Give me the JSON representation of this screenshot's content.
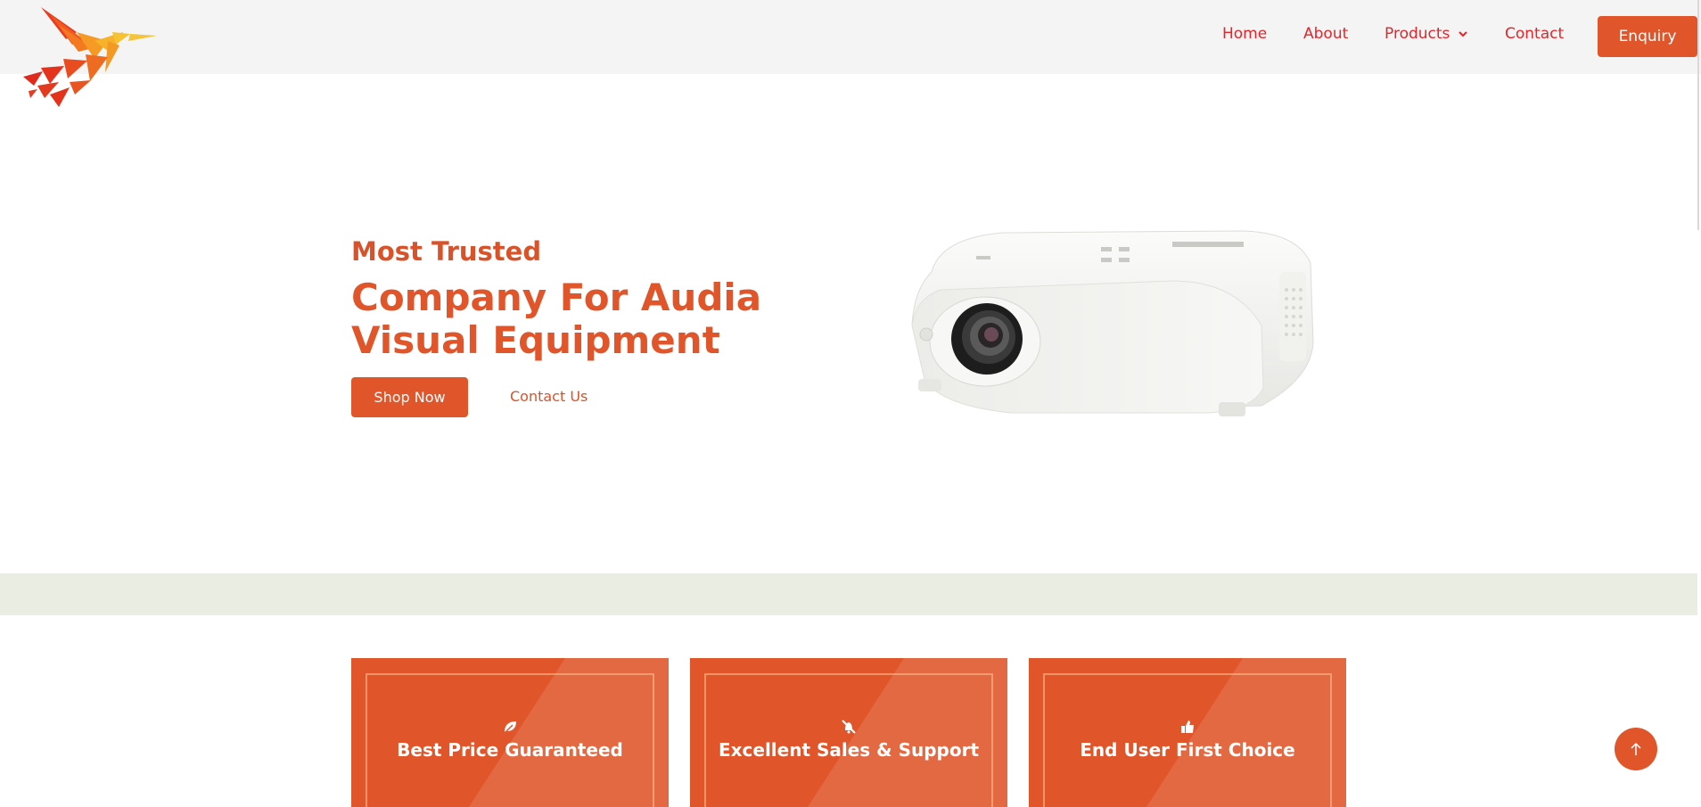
{
  "nav": {
    "home": "Home",
    "about": "About",
    "products": "Products",
    "contact": "Contact",
    "enquiry": "Enquiry"
  },
  "hero": {
    "subtitle": "Most Trusted",
    "title": "Company For Audia Visual Equipment",
    "shop_button": "Shop Now",
    "contact_link": "Contact Us"
  },
  "features": [
    {
      "label": "Best Price Guaranteed",
      "icon": "leaf-icon"
    },
    {
      "label": "Excellent Sales & Support",
      "icon": "no-bell-icon"
    },
    {
      "label": "End User First Choice",
      "icon": "thumbs-up-icon"
    }
  ],
  "colors": {
    "accent": "#e0552a",
    "nav_text": "#e0262b",
    "header_bg": "#f4f4f4",
    "band_bg": "#e9ede2"
  }
}
